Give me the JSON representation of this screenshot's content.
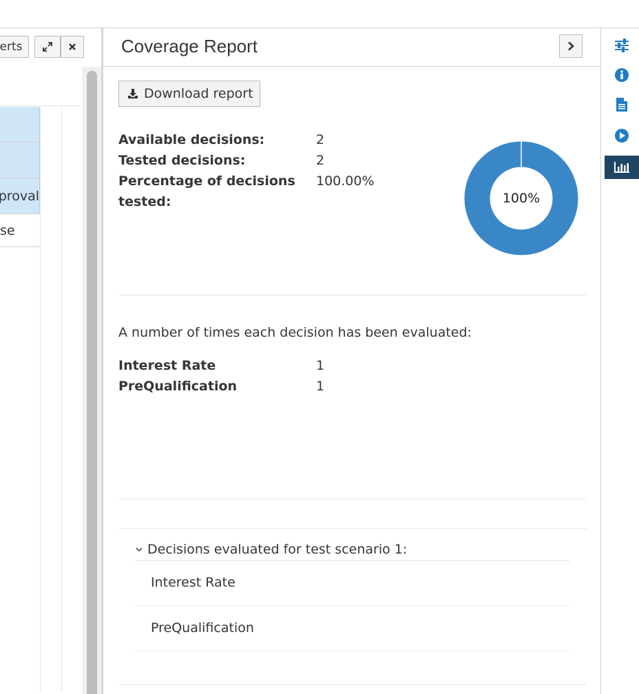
{
  "left_panel": {
    "toolbar": {
      "partial_button_label": "erts"
    },
    "grid_rows": [
      "",
      "",
      "proval",
      "se"
    ]
  },
  "report": {
    "title": "Coverage Report",
    "download_label": "Download report",
    "stats": [
      {
        "label": "Available decisions:",
        "value": "2"
      },
      {
        "label": "Tested decisions:",
        "value": "2"
      },
      {
        "label": "Percentage of decisions",
        "label2": "tested:",
        "value": "100.00%"
      }
    ],
    "donut": {
      "label": "100%",
      "percent": 100,
      "color": "#3a87c8"
    },
    "eval_intro": "A number of times each decision has been evaluated:",
    "evaluations": [
      {
        "name": "Interest Rate",
        "count": "1"
      },
      {
        "name": "PreQualification",
        "count": "1"
      }
    ],
    "scenario": {
      "title": "Decisions evaluated for test scenario 1:",
      "items": [
        "Interest Rate",
        "PreQualification"
      ]
    }
  },
  "right_rail": {
    "icons": [
      "sliders-icon",
      "info-icon",
      "document-icon",
      "play-icon",
      "bar-chart-icon"
    ],
    "active_icon": "bar-chart-icon",
    "color": "#1f7dc4"
  }
}
